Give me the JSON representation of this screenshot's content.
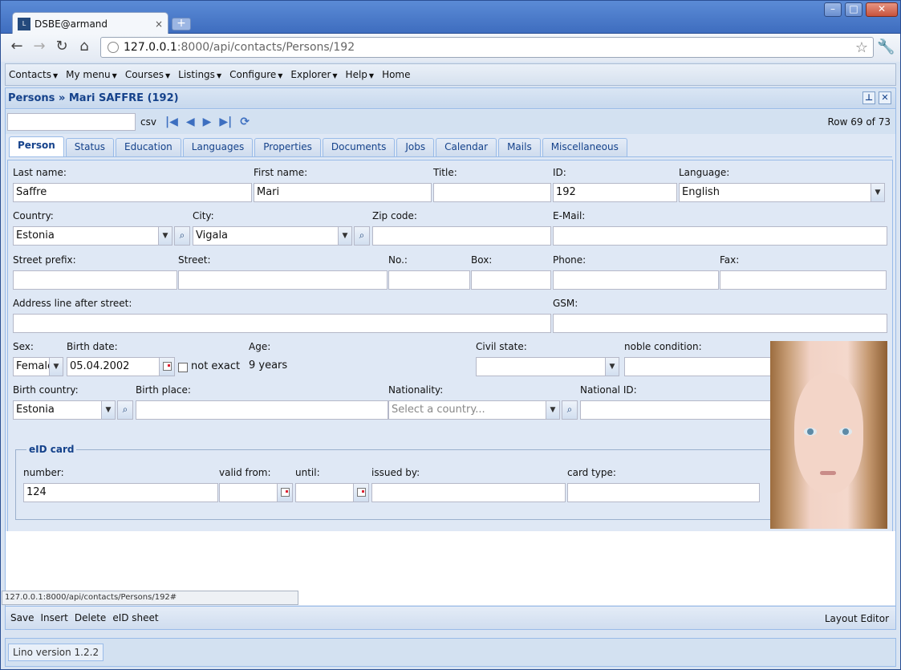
{
  "browser": {
    "tab_title": "DSBE@armand",
    "favicon_text": "L",
    "tab_close": "×",
    "new_tab": "+",
    "address_host": "127.0.0.1",
    "address_path": ":8000/api/contacts/Persons/192",
    "status_url": "127.0.0.1:8000/api/contacts/Persons/192#"
  },
  "menu": [
    {
      "label": "Contacts"
    },
    {
      "label": "My menu"
    },
    {
      "label": "Courses"
    },
    {
      "label": "Listings"
    },
    {
      "label": "Configure"
    },
    {
      "label": "Explorer"
    },
    {
      "label": "Help"
    },
    {
      "label": "Home",
      "plain": true
    }
  ],
  "panel": {
    "title": "Persons » Mari SAFFRE (192)",
    "csv": "csv",
    "row_info": "Row 69 of 73"
  },
  "tabs": [
    "Person",
    "Status",
    "Education",
    "Languages",
    "Properties",
    "Documents",
    "Jobs",
    "Calendar",
    "Mails",
    "Miscellaneous"
  ],
  "form": {
    "last_name_label": "Last name:",
    "last_name": "Saffre",
    "first_name_label": "First name:",
    "first_name": "Mari",
    "title_label": "Title:",
    "title": "",
    "id_label": "ID:",
    "id": "192",
    "language_label": "Language:",
    "language": "English",
    "country_label": "Country:",
    "country": "Estonia",
    "city_label": "City:",
    "city": "Vigala",
    "zip_label": "Zip code:",
    "zip": "",
    "email_label": "E-Mail:",
    "email": "",
    "street_prefix_label": "Street prefix:",
    "street_label": "Street:",
    "no_label": "No.:",
    "box_label": "Box:",
    "phone_label": "Phone:",
    "fax_label": "Fax:",
    "addr_after_label": "Address line after street:",
    "gsm_label": "GSM:",
    "sex_label": "Sex:",
    "sex": "Female",
    "birth_date_label": "Birth date:",
    "birth_date": "05.04.2002",
    "not_exact": "not exact",
    "age_label": "Age:",
    "age": "9 years",
    "civil_state_label": "Civil state:",
    "noble_label": "noble condition:",
    "birth_country_label": "Birth country:",
    "birth_country": "Estonia",
    "birth_place_label": "Birth place:",
    "nationality_label": "Nationality:",
    "nationality_placeholder": "Select a country...",
    "national_id_label": "National ID:"
  },
  "eid": {
    "legend": "eID card",
    "number_label": "number:",
    "number": "124",
    "valid_from_label": "valid from:",
    "until_label": "until:",
    "issued_by_label": "issued by:",
    "card_type_label": "card type:"
  },
  "actions": [
    "Save",
    "Insert",
    "Delete",
    "eID sheet"
  ],
  "layout_editor": "Layout Editor",
  "version": "Lino version 1.2.2"
}
